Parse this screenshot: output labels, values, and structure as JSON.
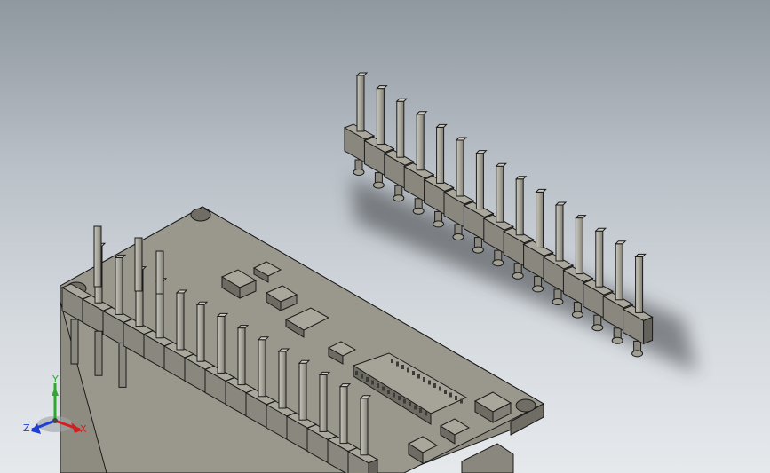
{
  "scene": {
    "description_visible": false,
    "colors": {
      "background_top": "#8f979f",
      "background_bottom": "#e6e9ec",
      "part_face": "#8d8b80",
      "part_top": "#a3a195",
      "part_dark": "#5f5d55",
      "edge": "#1a1a1a",
      "axis_x": "#d21f1f",
      "axis_y": "#2fa82f",
      "axis_z": "#1f3fd2"
    }
  },
  "triad": {
    "x_label": "X",
    "y_label": "Y",
    "z_label": "Z"
  },
  "header_strip": {
    "pin_count": 15
  }
}
